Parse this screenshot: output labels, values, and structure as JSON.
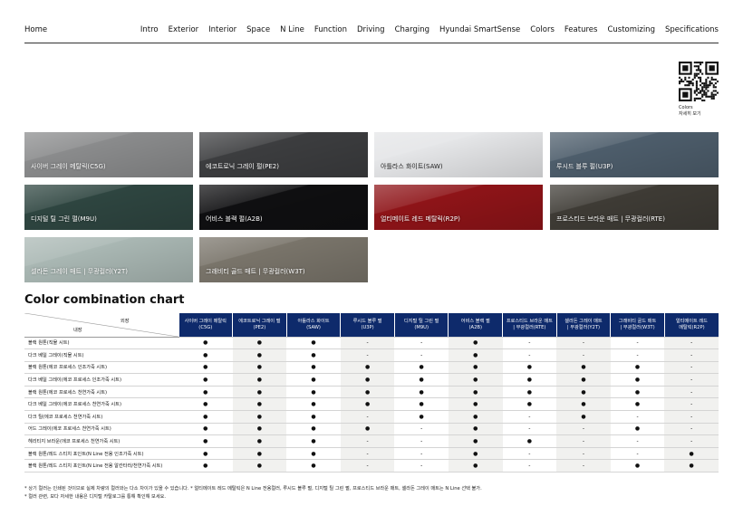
{
  "nav": {
    "home": "Home",
    "items": [
      "Intro",
      "Exterior",
      "Interior",
      "Space",
      "N Line",
      "Function",
      "Driving",
      "Charging",
      "Hyundai SmartSense",
      "Colors",
      "Features",
      "Customizing",
      "Specifications"
    ]
  },
  "qr_caption": {
    "line1": "Colors",
    "line2": "자세히 보기"
  },
  "swatches": [
    {
      "label": "사이버 그레이 메탈릭(C5G)",
      "color": "#8a8b8c"
    },
    {
      "label": "에코트로닉 그레이 펄(PE2)",
      "color": "#3c3d3f"
    },
    {
      "label": "아틀라스 화이트(SAW)",
      "color": "#e4e5e7"
    },
    {
      "label": "루시드 블루 펄(U3P)",
      "color": "#4d5d6b"
    },
    {
      "label": "디지털 틸 그린 펄(M9U)",
      "color": "#2e4540"
    },
    {
      "label": "어비스 블랙 펄(A2B)",
      "color": "#0f0f11"
    },
    {
      "label": "얼티메이트 레드 메탈릭(R2P)",
      "color": "#8e1418"
    },
    {
      "label": "프로스티드 브라운 매트 | 무광컬러(RTE)",
      "color": "#3e3b35"
    },
    {
      "label": "셀라돈 그레이 매트 | 무광컬러(Y2T)",
      "color": "#a9b7b3"
    },
    {
      "label": "그래비티 골드 매트 | 무광컬러(W3T)",
      "color": "#79746a"
    }
  ],
  "chart_title": "Color combination chart",
  "table": {
    "corner_exterior": "외장",
    "corner_interior": "내장",
    "columns": [
      {
        "line1": "사이버 그레이 메탈릭",
        "line2": "(C5G)"
      },
      {
        "line1": "에코트로닉 그레이 펄",
        "line2": "(PE2)"
      },
      {
        "line1": "아틀라스 화이트",
        "line2": "(SAW)"
      },
      {
        "line1": "루시드 블루 펄",
        "line2": "(U3P)"
      },
      {
        "line1": "디지털 틸 그린 펄",
        "line2": "(M9U)"
      },
      {
        "line1": "어비스 블랙 펄",
        "line2": "(A2B)"
      },
      {
        "line1": "프로스티드 브라운 매트",
        "line2": "| 무광컬러(RTE)"
      },
      {
        "line1": "셀라돈 그레이 매트",
        "line2": "| 무광컬러(Y2T)"
      },
      {
        "line1": "그래비티 골드 매트",
        "line2": "| 무광컬러(W3T)"
      },
      {
        "line1": "얼티메이트 레드",
        "line2": "메탈릭(R2P)"
      }
    ],
    "rows": [
      {
        "name": "블랙 원톤(직물 시트)",
        "cells": [
          "●",
          "●",
          "●",
          "-",
          "-",
          "●",
          "-",
          "-",
          "-",
          "-"
        ]
      },
      {
        "name": "다크 베일 그레이(직물 시트)",
        "cells": [
          "●",
          "●",
          "●",
          "-",
          "-",
          "●",
          "-",
          "-",
          "-",
          "-"
        ]
      },
      {
        "name": "블랙 원톤(에코 프로세스 인조가죽 시트)",
        "cells": [
          "●",
          "●",
          "●",
          "●",
          "●",
          "●",
          "●",
          "●",
          "●",
          "-"
        ]
      },
      {
        "name": "다크 베일 그레이(에코 프로세스 인조가죽 시트)",
        "cells": [
          "●",
          "●",
          "●",
          "●",
          "●",
          "●",
          "●",
          "●",
          "●",
          "-"
        ]
      },
      {
        "name": "블랙 원톤(에코 프로세스 천연가죽 시트)",
        "cells": [
          "●",
          "●",
          "●",
          "●",
          "●",
          "●",
          "●",
          "●",
          "●",
          "-"
        ]
      },
      {
        "name": "다크 베일 그레이(에코 프로세스 천연가죽 시트)",
        "cells": [
          "●",
          "●",
          "●",
          "●",
          "●",
          "●",
          "●",
          "●",
          "●",
          "-"
        ]
      },
      {
        "name": "다크 틸(에코 프로세스 천연가죽 시트)",
        "cells": [
          "●",
          "●",
          "●",
          "-",
          "●",
          "●",
          "-",
          "●",
          "-",
          "-"
        ]
      },
      {
        "name": "어드 그레이(에코 프로세스 천연가죽 시트)",
        "cells": [
          "●",
          "●",
          "●",
          "●",
          "-",
          "●",
          "-",
          "-",
          "●",
          "-"
        ]
      },
      {
        "name": "헤리티지 브라운(에코 프로세스 천연가죽 시트)",
        "cells": [
          "●",
          "●",
          "●",
          "-",
          "-",
          "●",
          "●",
          "-",
          "-",
          "-"
        ]
      },
      {
        "name": "블랙 원톤/레드 스티치 포인트(N Line 전용 인조가죽 시트)",
        "cells": [
          "●",
          "●",
          "●",
          "-",
          "-",
          "●",
          "-",
          "-",
          "-",
          "●"
        ]
      },
      {
        "name": "블랙 원톤/레드 스티치 포인트(N Line 전용 알칸타라/천연가죽 시트)",
        "cells": [
          "●",
          "●",
          "●",
          "-",
          "-",
          "●",
          "-",
          "-",
          "●",
          "●"
        ]
      }
    ]
  },
  "footnotes": {
    "line1": "* 상기 컬러는 인쇄된 것이므로 실제 차량의 컬러와는 다소 차이가 있을 수 있습니다.  * 얼티메이트 레드 메탈릭은 N Line 전용컬러, 루시드 블루 펄, 디지털 틸 그린 펄, 프로스티드 브라운 매트, 셀라돈 그레이 매트는 N Line 선택 불가.",
    "line2": "* 컬러 관련, 보다 자세한 내용은 디지털 카탈로그를 통해 확인해 보세요."
  }
}
